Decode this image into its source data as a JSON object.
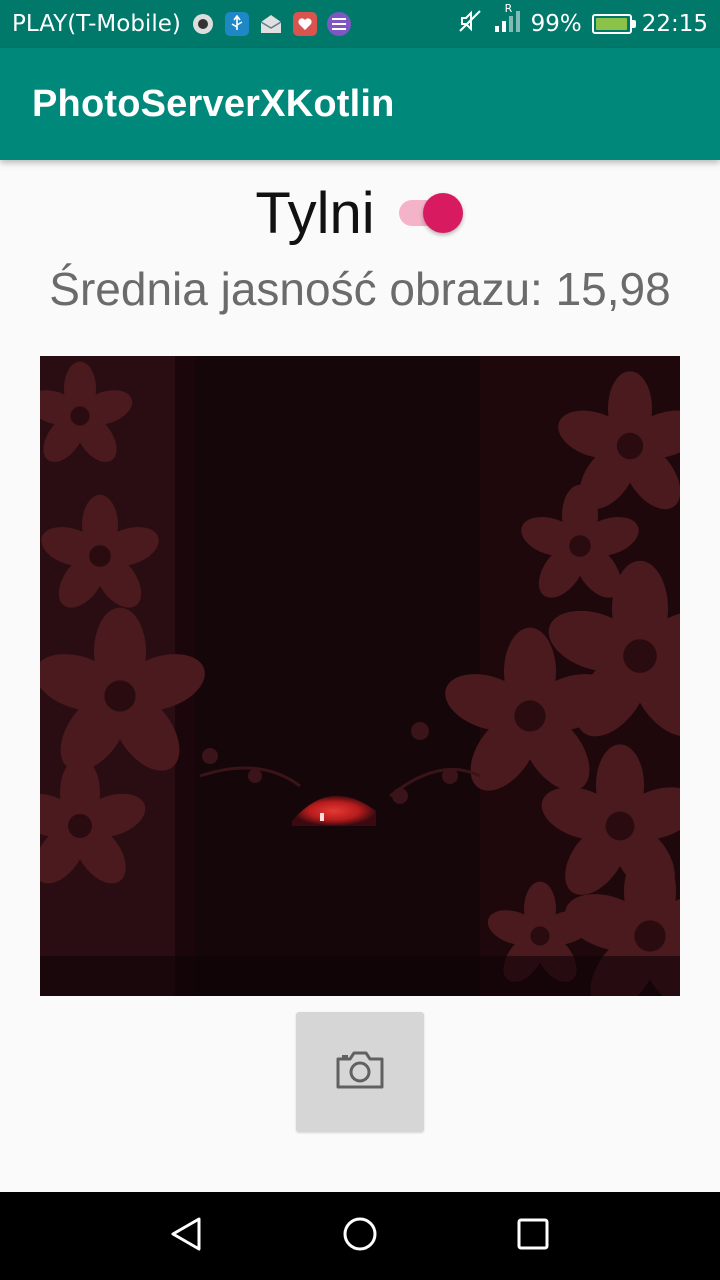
{
  "status_bar": {
    "carrier": "PLAY(T-Mobile)",
    "notification_icons": [
      "camera-app-icon",
      "usb-icon",
      "email-icon",
      "health-app-icon",
      "list-app-icon"
    ],
    "roaming_indicator": "R",
    "battery_percent": "99%",
    "battery_level": 0.99,
    "time": "22:15",
    "background": "#00796b"
  },
  "app_bar": {
    "title": "PhotoServerXKotlin",
    "background": "#00897b"
  },
  "camera_switch": {
    "label": "Tylni",
    "checked": true,
    "accent": "#d81b60"
  },
  "brightness": {
    "text": "Średnia jasność obrazu: 15,98"
  },
  "photo": {
    "description_icon": "photo-preview"
  },
  "take_photo_button": {
    "icon": "camera-icon"
  },
  "nav_bar": {
    "buttons": [
      "back-icon",
      "home-icon",
      "recents-icon"
    ]
  }
}
